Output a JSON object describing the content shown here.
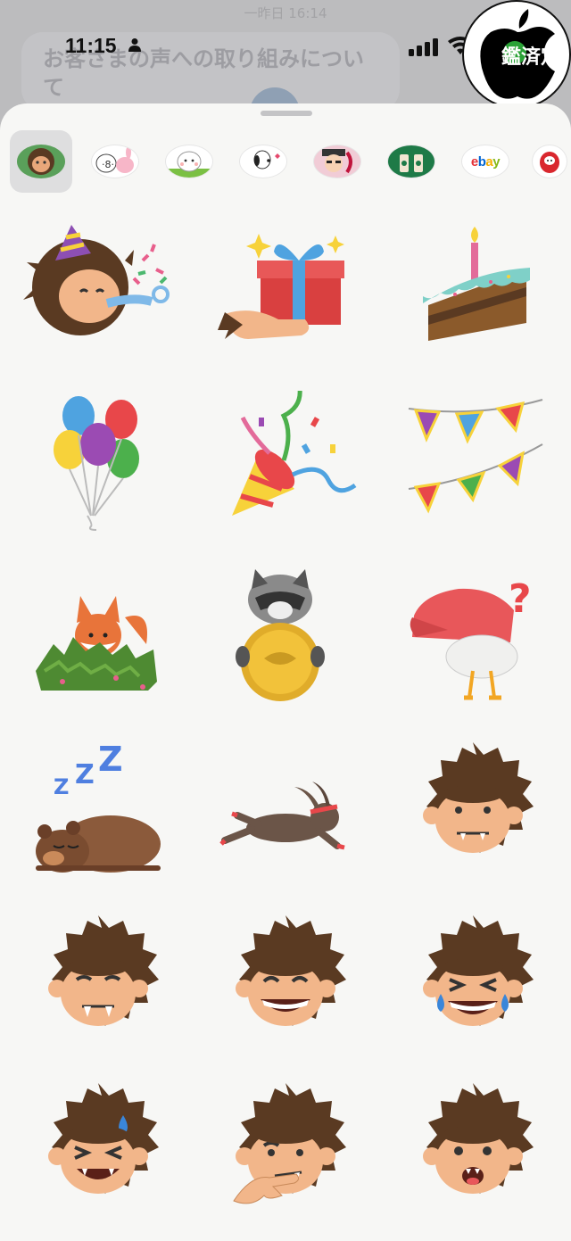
{
  "background": {
    "timestamp": "一昨日 16:14",
    "message_text": "お客さまの声への取り組みについて"
  },
  "status_bar": {
    "time": "11:15"
  },
  "watermark": {
    "text": "鑑済定"
  },
  "sticker_packs": [
    {
      "name": "hedgehog-pack",
      "selected": true
    },
    {
      "name": "rabbit-pack",
      "selected": false
    },
    {
      "name": "white-cat-pack",
      "selected": false
    },
    {
      "name": "snoopy-pack",
      "selected": false
    },
    {
      "name": "character-pack",
      "selected": false
    },
    {
      "name": "starbucks-pack",
      "selected": false
    },
    {
      "name": "ebay-pack",
      "label": "ebay",
      "selected": false
    },
    {
      "name": "daruma-pack",
      "selected": false
    }
  ],
  "stickers": [
    {
      "name": "party-hedgehog"
    },
    {
      "name": "gift-box"
    },
    {
      "name": "birthday-cake"
    },
    {
      "name": "balloons"
    },
    {
      "name": "party-popper"
    },
    {
      "name": "bunting-flags"
    },
    {
      "name": "fox-in-bush"
    },
    {
      "name": "raccoon-coin"
    },
    {
      "name": "duck-cap-question"
    },
    {
      "name": "sleeping-bear"
    },
    {
      "name": "running-rabbit"
    },
    {
      "name": "monster-neutral"
    },
    {
      "name": "monster-fangs"
    },
    {
      "name": "monster-grin"
    },
    {
      "name": "monster-laugh-tears"
    },
    {
      "name": "monster-sweat"
    },
    {
      "name": "monster-thinking"
    },
    {
      "name": "monster-surprised"
    }
  ]
}
